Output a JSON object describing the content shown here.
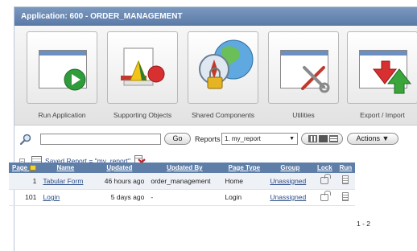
{
  "window": {
    "title": "Application: 600 - ORDER_MANAGEMENT"
  },
  "tiles": [
    {
      "label": "Run Application",
      "icon": "run-application-icon"
    },
    {
      "label": "Supporting Objects",
      "icon": "supporting-objects-icon"
    },
    {
      "label": "Shared Components",
      "icon": "shared-components-icon"
    },
    {
      "label": "Utilities",
      "icon": "utilities-icon"
    },
    {
      "label": "Export / Import",
      "icon": "export-import-icon"
    }
  ],
  "search": {
    "value": "",
    "go_label": "Go",
    "reports_label": "Reports",
    "report_selected": "1. my_report",
    "actions_label": "Actions ▼"
  },
  "saved_report": {
    "label": "Saved Report = \"my_report\""
  },
  "table": {
    "columns": [
      "Page",
      "Name",
      "Updated",
      "Updated By",
      "Page Type",
      "Group",
      "Lock",
      "Run"
    ],
    "rows": [
      {
        "page": "1",
        "name": "Tabular Form",
        "updated": "46 hours ago",
        "updated_by": "order_management",
        "page_type": "Home",
        "group": "Unassigned"
      },
      {
        "page": "101",
        "name": "Login",
        "updated": "5 days ago",
        "updated_by": "-",
        "page_type": "Login",
        "group": "Unassigned"
      }
    ],
    "pagination": "1 - 2"
  },
  "colors": {
    "header_blue": "#5e7ea8",
    "link_blue": "#2d4d8a",
    "play_green": "#2f9b3a",
    "delete_red": "#cc2222"
  }
}
